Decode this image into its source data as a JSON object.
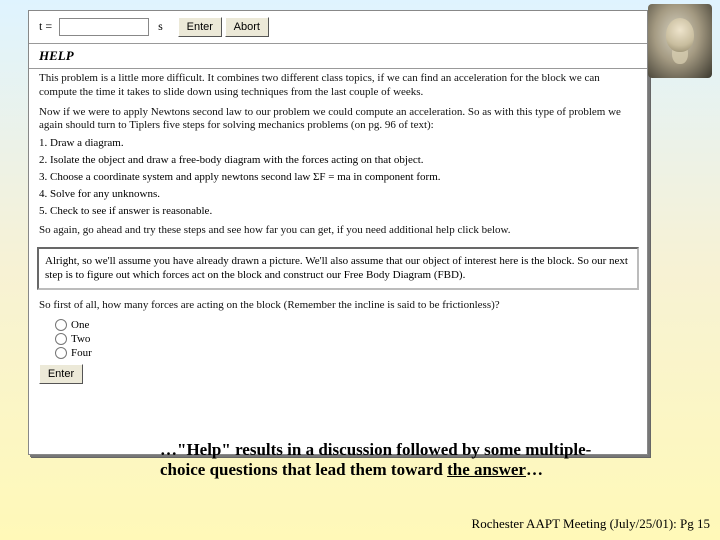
{
  "input": {
    "label": "t =",
    "value": "",
    "unit": "s",
    "enter": "Enter",
    "abort": "Abort"
  },
  "help": {
    "heading": "HELP",
    "p1": "This problem is a little more difficult. It combines two different class topics, if we can find an acceleration for the block we can compute the time it takes to slide down using techniques from the last couple of weeks.",
    "p2": "Now if we were to apply Newtons second law to our problem we could compute an acceleration. So as with this type of problem we again should turn to Tiplers five steps for solving mechanics problems (on pg. 96 of text):",
    "steps": [
      "1. Draw a diagram.",
      "2. Isolate the object and draw a free-body diagram with the forces acting on that object.",
      "3. Choose a coordinate system and apply newtons second law ΣF = ma in component form.",
      "4. Solve for any unknowns.",
      "5. Check to see if answer is reasonable."
    ],
    "p3": "So again, go ahead and try these steps and see how far you can get, if you need additional help click below.",
    "inset": "Alright, so we'll assume you have already drawn a picture. We'll also assume that our object of interest here is the block. So our next step is to figure out which forces act on the block and construct our Free Body Diagram (FBD).",
    "q": "So first of all, how many forces are acting on the block (Remember the incline is said to be frictionless)?",
    "opts": [
      "One",
      "Two",
      "Four"
    ],
    "enter2": "Enter"
  },
  "callout_pre": "…\"Help\" results in a discussion followed by some multiple-choice questions that lead them toward ",
  "callout_u": "the answer",
  "callout_post": "…",
  "footer": "Rochester AAPT Meeting (July/25/01): Pg 15"
}
